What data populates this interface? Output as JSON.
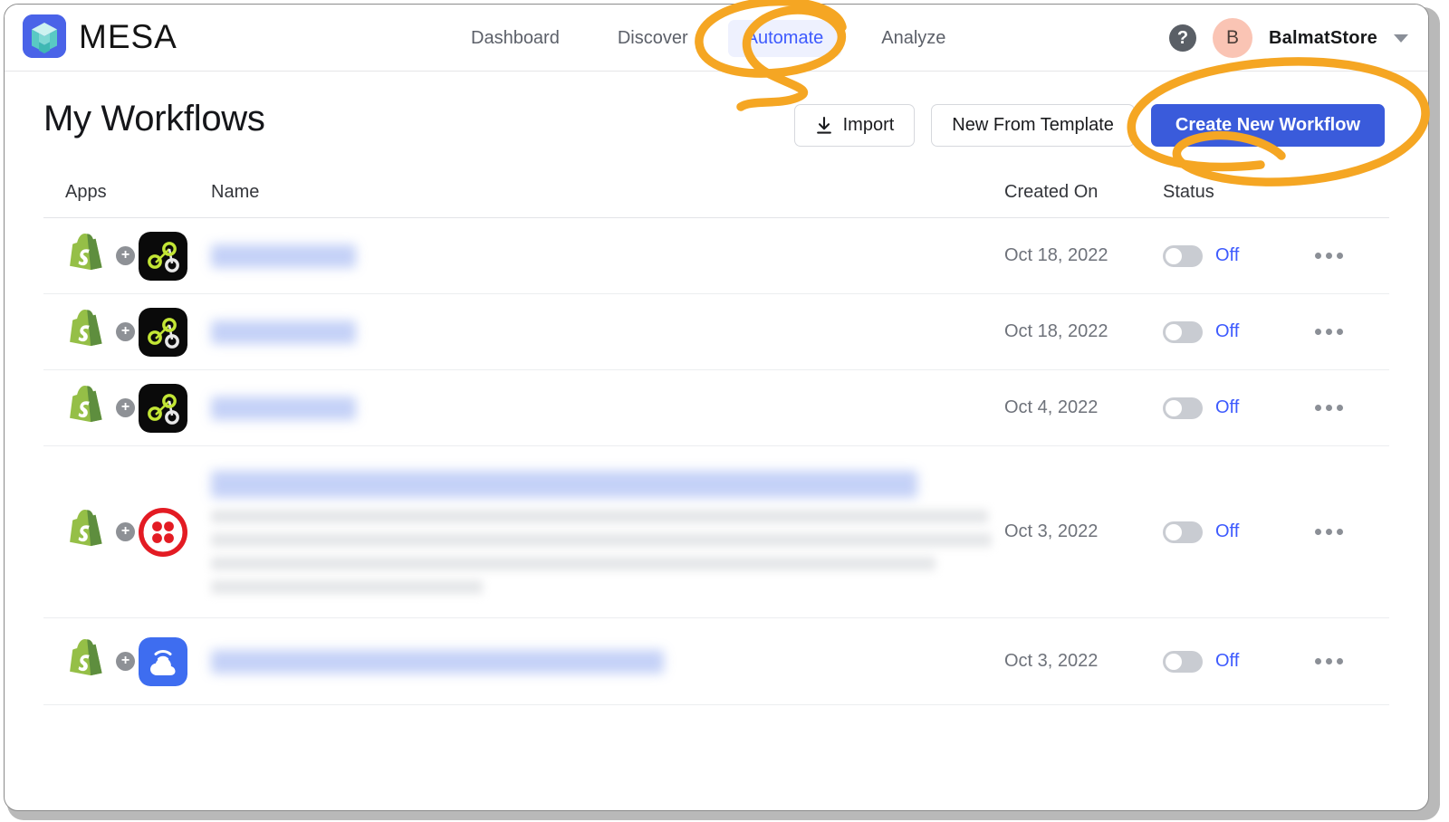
{
  "brand": {
    "name": "MESA",
    "logo_icon": "mesa-cube-icon"
  },
  "nav": {
    "links": [
      {
        "label": "Dashboard",
        "active": false
      },
      {
        "label": "Discover",
        "active": false
      },
      {
        "label": "Automate",
        "active": true
      },
      {
        "label": "Analyze",
        "active": false
      }
    ],
    "help_icon": "question-mark-icon",
    "avatar_initial": "B",
    "store_name": "BalmatStore",
    "caret_icon": "chevron-down-icon"
  },
  "page": {
    "title": "My Workflows",
    "buttons": {
      "import": "Import",
      "import_icon": "download-icon",
      "new_from_template": "New From Template",
      "create_new": "Create New Workflow"
    }
  },
  "table": {
    "headers": {
      "apps": "Apps",
      "name": "Name",
      "created_on": "Created On",
      "status": "Status"
    },
    "rows": [
      {
        "app_from": "shopify-icon",
        "app_to": "flow-nodes-icon",
        "name": "",
        "name_redacted": true,
        "description_lines": 0,
        "created_on": "Oct 18, 2022",
        "status": "Off",
        "status_on": false,
        "menu_icon": "more-options-icon"
      },
      {
        "app_from": "shopify-icon",
        "app_to": "flow-nodes-icon",
        "name": "",
        "name_redacted": true,
        "description_lines": 0,
        "created_on": "Oct 18, 2022",
        "status": "Off",
        "status_on": false,
        "menu_icon": "more-options-icon"
      },
      {
        "app_from": "shopify-icon",
        "app_to": "flow-nodes-icon",
        "name": "",
        "name_redacted": true,
        "description_lines": 0,
        "created_on": "Oct 4, 2022",
        "status": "Off",
        "status_on": false,
        "menu_icon": "more-options-icon"
      },
      {
        "app_from": "shopify-icon",
        "app_to": "twilio-icon",
        "name": "",
        "name_redacted": true,
        "description_lines": 4,
        "created_on": "Oct 3, 2022",
        "status": "Off",
        "status_on": false,
        "menu_icon": "more-options-icon"
      },
      {
        "app_from": "shopify-icon",
        "app_to": "cloud-sms-icon",
        "name": "",
        "name_redacted": true,
        "description_lines": 0,
        "created_on": "Oct 3, 2022",
        "status": "Off",
        "status_on": false,
        "menu_icon": "more-options-icon"
      }
    ]
  },
  "annotations": {
    "color": "#F5A623",
    "marks": [
      {
        "name": "circle-around-automate-tab",
        "target": "Automate"
      },
      {
        "name": "circle-around-create-new-workflow-button",
        "target": "Create New Workflow"
      }
    ]
  },
  "colors": {
    "accent_blue": "#3d5afe",
    "primary_button": "#3a5bdb",
    "annotation_orange": "#F5A623",
    "avatar_bg": "#fac4b4",
    "shopify_green": "#95BF47",
    "twilio_red": "#F22F46"
  }
}
